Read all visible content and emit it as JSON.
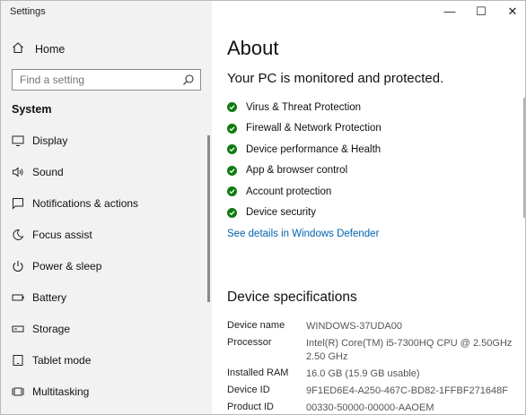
{
  "window": {
    "title": "Settings",
    "controls": [
      "—",
      "☐",
      "✕"
    ]
  },
  "sidebar": {
    "home_label": "Home",
    "search_placeholder": "Find a setting",
    "section_title": "System",
    "items": [
      {
        "label": "Display",
        "icon": "display-icon"
      },
      {
        "label": "Sound",
        "icon": "sound-icon"
      },
      {
        "label": "Notifications & actions",
        "icon": "notifications-icon"
      },
      {
        "label": "Focus assist",
        "icon": "moon-icon"
      },
      {
        "label": "Power & sleep",
        "icon": "power-icon"
      },
      {
        "label": "Battery",
        "icon": "battery-icon"
      },
      {
        "label": "Storage",
        "icon": "storage-icon"
      },
      {
        "label": "Tablet mode",
        "icon": "tablet-icon"
      },
      {
        "label": "Multitasking",
        "icon": "multitasking-icon"
      }
    ]
  },
  "main": {
    "title": "About",
    "protection_status": "Your PC is monitored and protected.",
    "protections": [
      "Virus & Threat Protection",
      "Firewall & Network Protection",
      "Device performance & Health",
      "App & browser control",
      "Account protection",
      "Device security"
    ],
    "defender_link": "See details in Windows Defender",
    "specs_title": "Device specifications",
    "specs": [
      {
        "key": "Device name",
        "value": "WINDOWS-37UDA00"
      },
      {
        "key": "Processor",
        "value": "Intel(R) Core(TM) i5-7300HQ CPU @ 2.50GHz 2.50 GHz"
      },
      {
        "key": "Installed RAM",
        "value": "16.0 GB (15.9 GB usable)"
      },
      {
        "key": "Device ID",
        "value": "9F1ED6E4-A250-467C-BD82-1FFBF271648F"
      },
      {
        "key": "Product ID",
        "value": "00330-50000-00000-AAOEM"
      }
    ]
  },
  "colors": {
    "accent": "#0063b1",
    "check_green": "#107c10",
    "sidebar_bg": "#f2f2f2"
  }
}
